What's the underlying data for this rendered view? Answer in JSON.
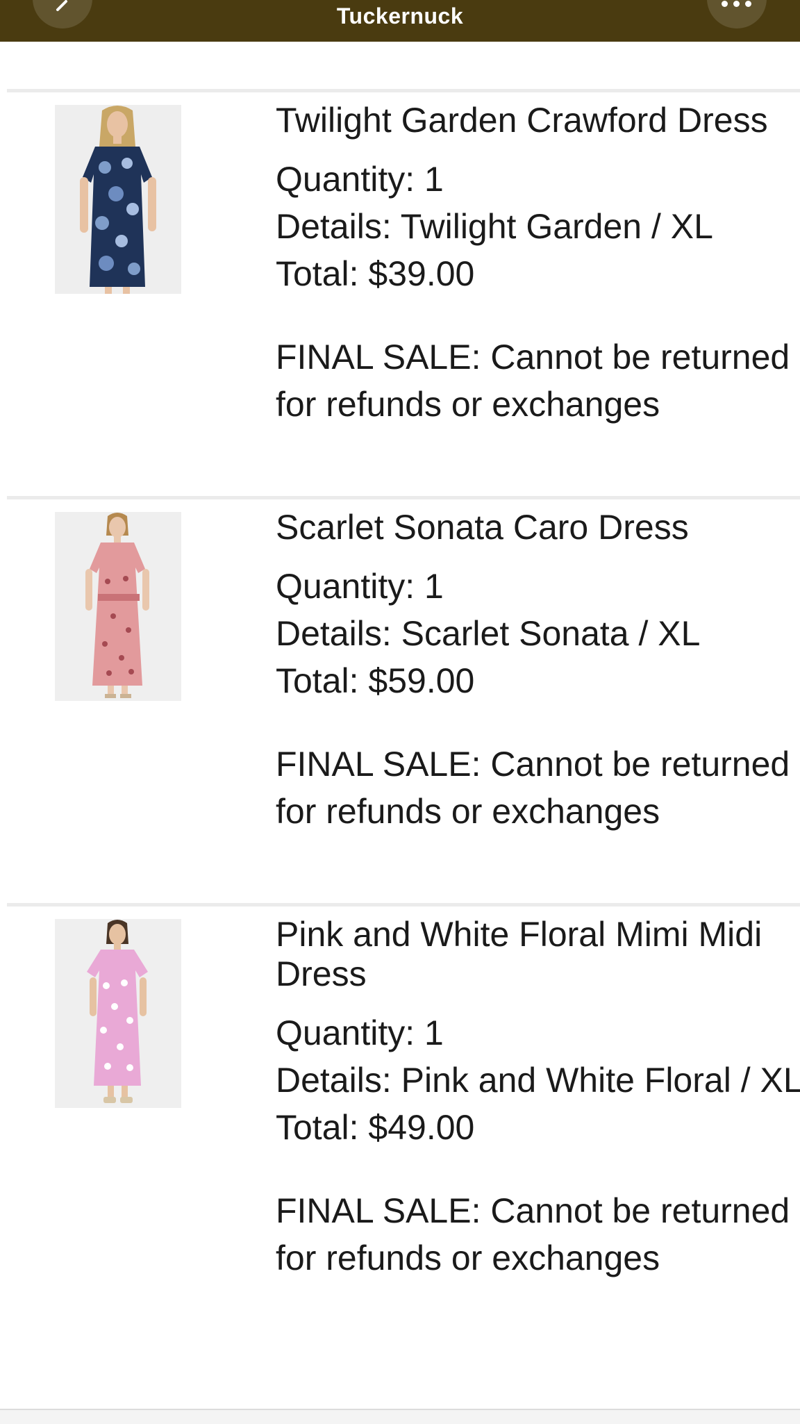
{
  "header": {
    "title": "Tuckernuck",
    "background_color": "#4a3b10",
    "back_icon": "chevron-left-icon",
    "more_icon": "more-horizontal-icon"
  },
  "items": [
    {
      "name": "Twilight Garden Crawford Dress",
      "quantity": "Quantity: 1",
      "details": "Details: Twilight Garden / XL",
      "total": "Total: $39.00",
      "final_sale_line1": "FINAL SALE: Cannot be returned",
      "final_sale_line2": "for refunds or exchanges"
    },
    {
      "name": "Scarlet Sonata Caro Dress",
      "quantity": "Quantity: 1",
      "details": "Details: Scarlet Sonata / XL",
      "total": "Total: $59.00",
      "final_sale_line1": "FINAL SALE: Cannot be returned",
      "final_sale_line2": "for refunds or exchanges"
    },
    {
      "name_line1": "Pink and White Floral Mimi Midi",
      "name_line2": "Dress",
      "quantity": "Quantity: 1",
      "details": "Details: Pink and White Floral / XL",
      "total": "Total: $49.00",
      "final_sale_line1": "FINAL SALE: Cannot be returned",
      "final_sale_line2": "for refunds or exchanges"
    }
  ]
}
